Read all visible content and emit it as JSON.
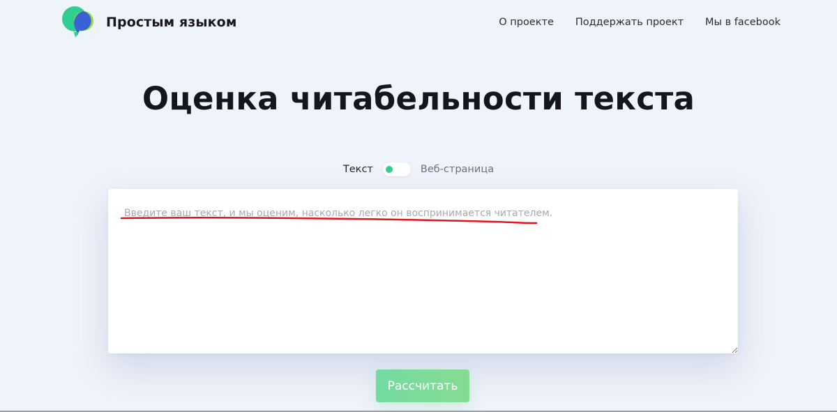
{
  "header": {
    "brand_name": "Простым языком",
    "logo_icon": "speech-bubbles-logo-icon",
    "nav": [
      {
        "label": "О проекте"
      },
      {
        "label": "Поддержать проект"
      },
      {
        "label": "Мы в facebook"
      }
    ]
  },
  "main": {
    "title": "Оценка читабельности текста",
    "mode_switch": {
      "left_label": "Текст",
      "right_label": "Веб-страница",
      "selected": "Текст"
    },
    "text_input": {
      "placeholder": "Введите ваш текст, и мы оценим, насколько легко он воспринимается читателем.",
      "value": ""
    },
    "submit_label": "Рассчитать"
  },
  "colors": {
    "background": "#eff3fa",
    "accent_green": "#2fcf8d",
    "button_green": "#7bdb9a",
    "logo_blue": "#3a62d6",
    "annotation_red": "#e0141a"
  }
}
